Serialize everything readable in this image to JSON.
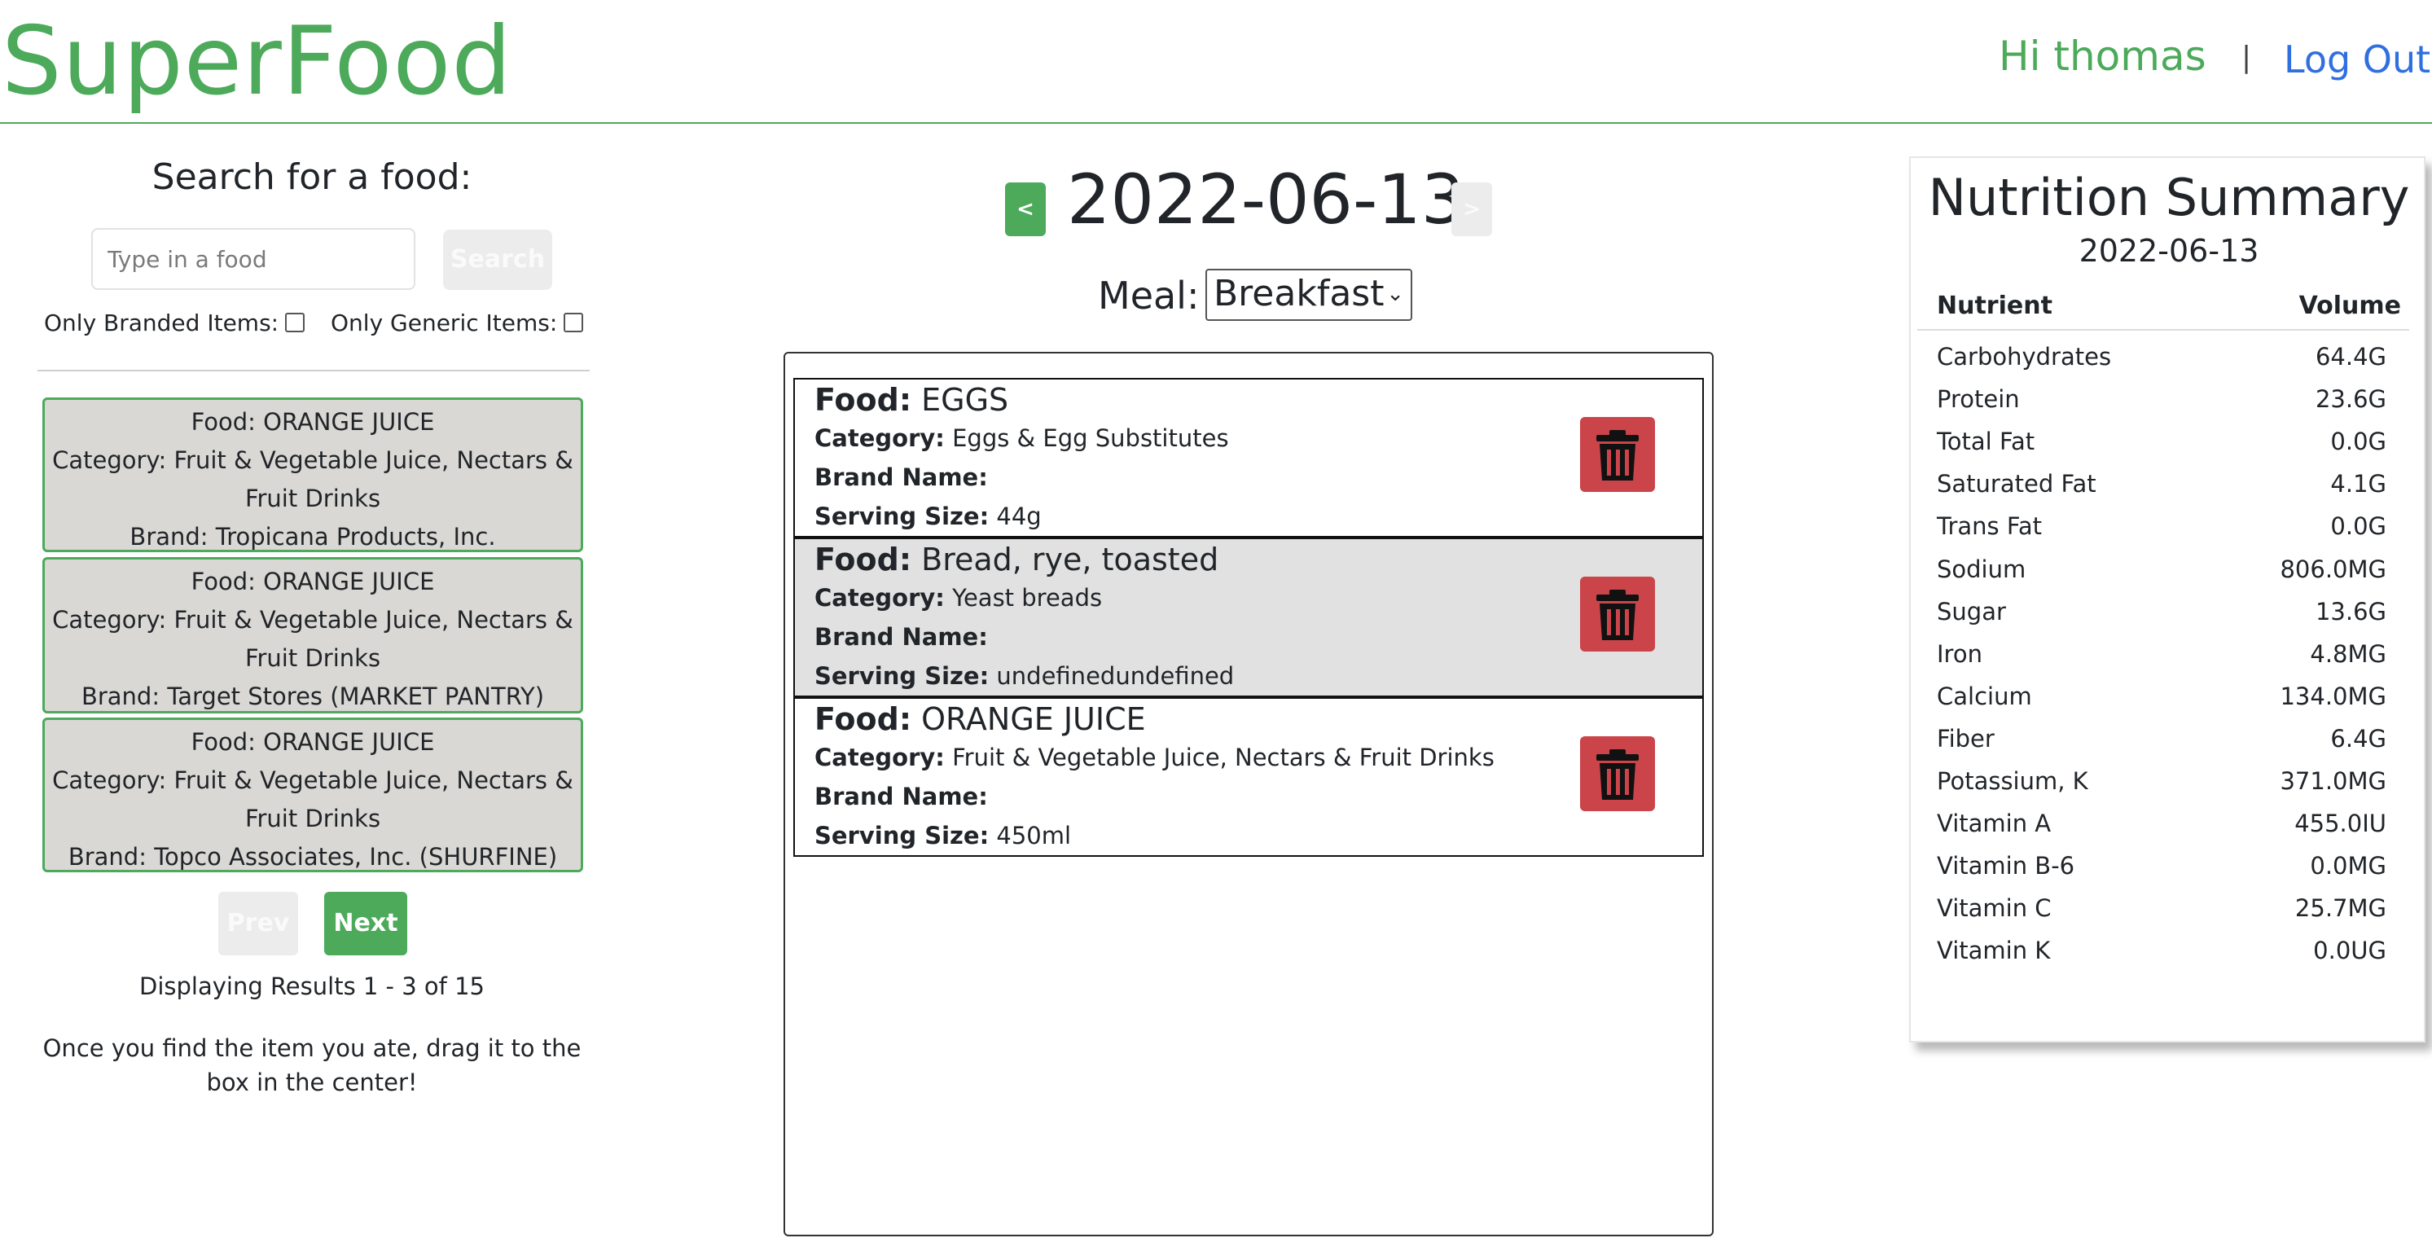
{
  "header": {
    "brand": "SuperFood",
    "greeting": "Hi thomas",
    "separator": "|",
    "logout": "Log Out"
  },
  "search": {
    "title": "Search for a food:",
    "placeholder": "Type in a food",
    "button": "Search",
    "only_branded": "Only Branded Items:",
    "only_generic": "Only Generic Items:"
  },
  "results": [
    {
      "food": "Food: ORANGE JUICE",
      "category1": "Category: Fruit & Vegetable Juice, Nectars &",
      "category2": "Fruit Drinks",
      "brand": "Brand: Tropicana Products, Inc."
    },
    {
      "food": "Food: ORANGE JUICE",
      "category1": "Category: Fruit & Vegetable Juice, Nectars &",
      "category2": "Fruit Drinks",
      "brand": "Brand: Target Stores (MARKET PANTRY)"
    },
    {
      "food": "Food: ORANGE JUICE",
      "category1": "Category: Fruit & Vegetable Juice, Nectars &",
      "category2": "Fruit Drinks",
      "brand": "Brand: Topco Associates, Inc. (SHURFINE)"
    }
  ],
  "pager": {
    "prev": "Prev",
    "next": "Next",
    "status": "Displaying Results 1 - 3 of 15",
    "instructions": "Once you find the item you ate, drag it to the box in the center!"
  },
  "day": {
    "prev": "<",
    "date": "2022-06-13",
    "next": ">",
    "meal_label": "Meal:",
    "meal_value": "Breakfast"
  },
  "labels": {
    "food": "Food:",
    "category": "Category:",
    "brand": "Brand Name:",
    "serving": "Serving Size:"
  },
  "meal_items": [
    {
      "food": "EGGS",
      "category": "Eggs & Egg Substitutes",
      "brand": "",
      "serving": "44g"
    },
    {
      "food": "Bread, rye, toasted",
      "category": "Yeast breads",
      "brand": "",
      "serving": "undefinedundefined"
    },
    {
      "food": "ORANGE JUICE",
      "category": "Fruit & Vegetable Juice, Nectars & Fruit Drinks",
      "brand": "",
      "serving": "450ml"
    }
  ],
  "nutrition": {
    "title": "Nutrition Summary",
    "date": "2022-06-13",
    "col_nutrient": "Nutrient",
    "col_volume": "Volume",
    "rows": [
      {
        "name": "Carbohydrates",
        "value": "64.4G"
      },
      {
        "name": "Protein",
        "value": "23.6G"
      },
      {
        "name": "Total Fat",
        "value": "0.0G"
      },
      {
        "name": "Saturated Fat",
        "value": "4.1G"
      },
      {
        "name": "Trans Fat",
        "value": "0.0G"
      },
      {
        "name": "Sodium",
        "value": "806.0MG"
      },
      {
        "name": "Sugar",
        "value": "13.6G"
      },
      {
        "name": "Iron",
        "value": "4.8MG"
      },
      {
        "name": "Calcium",
        "value": "134.0MG"
      },
      {
        "name": "Fiber",
        "value": "6.4G"
      },
      {
        "name": "Potassium, K",
        "value": "371.0MG"
      },
      {
        "name": "Vitamin A",
        "value": "455.0IU"
      },
      {
        "name": "Vitamin B-6",
        "value": "0.0MG"
      },
      {
        "name": "Vitamin C",
        "value": "25.7MG"
      },
      {
        "name": "Vitamin K",
        "value": "0.0UG"
      }
    ]
  },
  "colors": {
    "brand_green": "#4caa5a",
    "delete_red": "#cb444a",
    "link_blue": "#2f6fe0"
  }
}
